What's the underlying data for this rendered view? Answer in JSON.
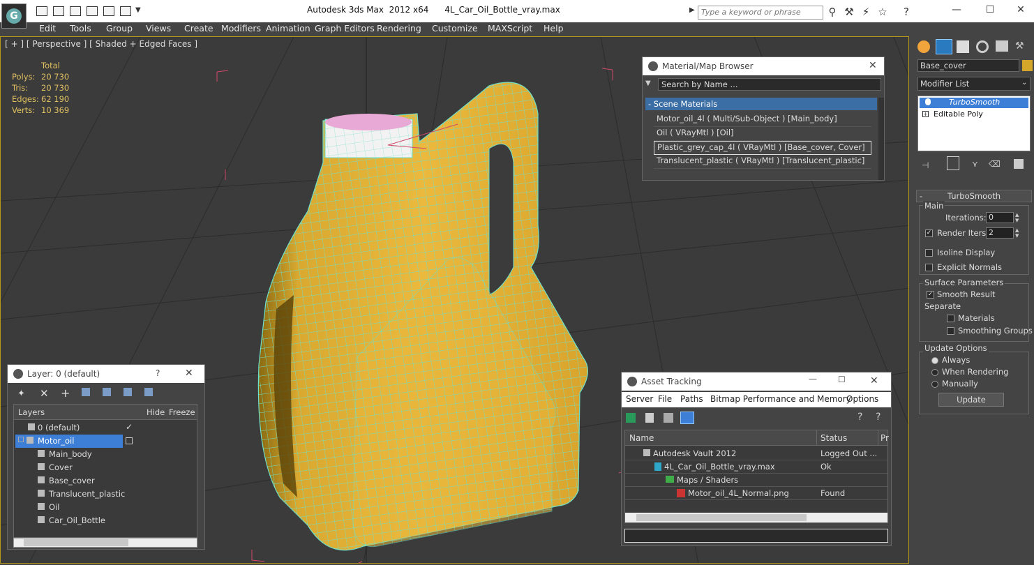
{
  "title_bar": {
    "app_title": "Autodesk 3ds Max  2012 x64",
    "file_name": "4L_Car_Oil_Bottle_vray.max",
    "search_placeholder": "Type a keyword or phrase"
  },
  "menu": [
    "Edit",
    "Tools",
    "Group",
    "Views",
    "Create",
    "Modifiers",
    "Animation",
    "Graph Editors",
    "Rendering",
    "Customize",
    "MAXScript",
    "Help"
  ],
  "viewport": {
    "label": "[ + ] [ Perspective ] [ Shaded + Edged Faces ]",
    "stats": {
      "header": "Total",
      "rows": [
        {
          "label": "Polys:",
          "value": "20 730"
        },
        {
          "label": "Tris:",
          "value": "20 730"
        },
        {
          "label": "Edges:",
          "value": "62 190"
        },
        {
          "label": "Verts:",
          "value": "10 369"
        }
      ]
    },
    "gizmo": {
      "x": "x",
      "y": "y"
    }
  },
  "material_browser": {
    "title": "Material/Map Browser",
    "search_placeholder": "Search by Name ...",
    "section": "- Scene Materials",
    "items": [
      "Motor_oil_4l  ( Multi/Sub-Object ) [Main_body]",
      "Oil  ( VRayMtl ) [Oil]",
      "Plastic_grey_cap_4l  ( VRayMtl ) [Base_cover, Cover]",
      "Translucent_plastic  ( VRayMtl ) [Translucent_plastic]"
    ],
    "selected_index": 2
  },
  "layer_dialog": {
    "title": "Layer: 0 (default)",
    "help": "?",
    "columns": [
      "Layers",
      "Hide",
      "Freeze"
    ],
    "rows": [
      {
        "name": "0 (default)",
        "indent": 1
      },
      {
        "name": "Motor_oil",
        "indent": 0,
        "selected": true
      },
      {
        "name": "Main_body",
        "indent": 2
      },
      {
        "name": "Cover",
        "indent": 2
      },
      {
        "name": "Base_cover",
        "indent": 2
      },
      {
        "name": "Translucent_plastic",
        "indent": 2
      },
      {
        "name": "Oil",
        "indent": 2
      },
      {
        "name": "Car_Oil_Bottle",
        "indent": 2
      }
    ]
  },
  "asset_tracking": {
    "title": "Asset Tracking",
    "menu": [
      "Server",
      "File",
      "Paths",
      "Bitmap Performance and Memory",
      "Options"
    ],
    "columns": [
      "Name",
      "Status",
      "Pr"
    ],
    "rows": [
      {
        "name": "Autodesk Vault 2012",
        "status": "Logged Out ...",
        "indent": 1
      },
      {
        "name": "4L_Car_Oil_Bottle_vray.max",
        "status": "Ok",
        "indent": 2
      },
      {
        "name": "Maps / Shaders",
        "status": "",
        "indent": 3
      },
      {
        "name": "Motor_oil_4L_Normal.png",
        "status": "Found",
        "indent": 4
      }
    ]
  },
  "command_panel": {
    "object_name": "Base_cover",
    "modifier_list": "Modifier List",
    "stack": [
      "TurboSmooth",
      "Editable Poly"
    ],
    "rollout_title": "TurboSmooth",
    "main_group": "Main",
    "iterations_label": "Iterations:",
    "iterations_value": "0",
    "render_iters_label": "Render Iters:",
    "render_iters_value": "2",
    "isoline_label": "Isoline Display",
    "explicit_normals_label": "Explicit Normals",
    "surface_group": "Surface Parameters",
    "smooth_result_label": "Smooth Result",
    "separate_label": "Separate",
    "materials_label": "Materials",
    "smoothing_groups_label": "Smoothing Groups",
    "update_group": "Update Options",
    "always_label": "Always",
    "when_rendering_label": "When Rendering",
    "manually_label": "Manually",
    "update_button": "Update"
  },
  "colors": {
    "bottle": "#e8b63a",
    "wire": "#6fe0c8",
    "selection": "#3d7fd6",
    "viewport_bg": "#3b3b3b"
  }
}
